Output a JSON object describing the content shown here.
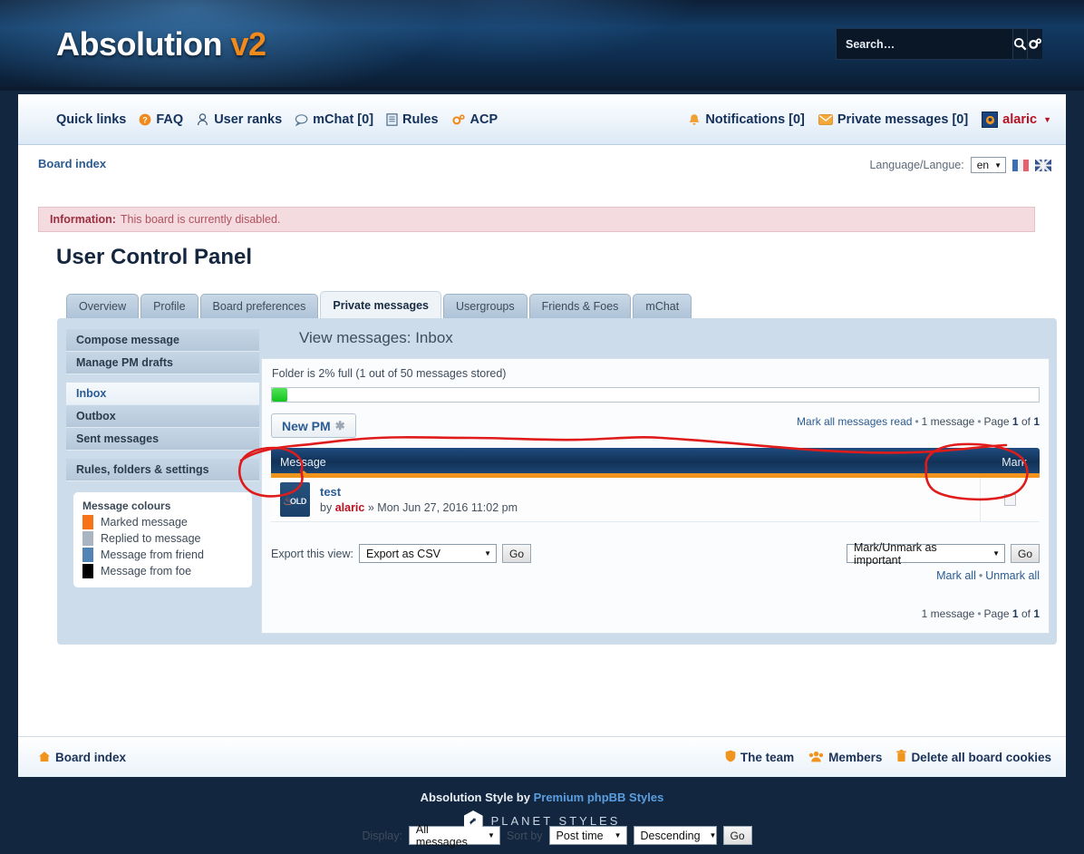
{
  "header": {
    "logo_main": "Absolution",
    "logo_suffix": "v2",
    "search_placeholder": "Search…",
    "search_value": "",
    "search_icon": "magnifier-icon",
    "search_options_icon": "gears-icon"
  },
  "nav": {
    "left": [
      {
        "label": "Quick links",
        "icon": "hamburger-icon"
      },
      {
        "label": "FAQ",
        "icon": "question-circle-icon"
      },
      {
        "label": "User ranks",
        "icon": "ranks-icon"
      },
      {
        "label": "mChat [0]",
        "icon": "chat-bubble-icon"
      },
      {
        "label": "Rules",
        "icon": "document-icon"
      },
      {
        "label": "ACP",
        "icon": "gears-icon"
      }
    ],
    "right": [
      {
        "label": "Notifications [0]",
        "icon": "bell-icon"
      },
      {
        "label": "Private messages [0]",
        "icon": "envelope-icon"
      }
    ],
    "username": "alaric",
    "user_avatar_icon": "avatar-icon",
    "user_caret": "▼"
  },
  "breadcrumb": {
    "label": "Board index",
    "icon": "none"
  },
  "language": {
    "label": "Language/Langue:",
    "selected": "en",
    "caret": "▼",
    "flags": [
      "flag-fr",
      "flag-gb"
    ]
  },
  "alert": {
    "label": "Information:",
    "text": "This board is currently disabled."
  },
  "page_title": "User Control Panel",
  "tabs": [
    {
      "label": "Overview",
      "active": false
    },
    {
      "label": "Profile",
      "active": false
    },
    {
      "label": "Board preferences",
      "active": false
    },
    {
      "label": "Private messages",
      "active": true
    },
    {
      "label": "Usergroups",
      "active": false
    },
    {
      "label": "Friends & Foes",
      "active": false
    },
    {
      "label": "mChat",
      "active": false
    }
  ],
  "sidebar": {
    "group1": [
      {
        "label": "Compose message",
        "active": false
      },
      {
        "label": "Manage PM drafts",
        "active": false
      }
    ],
    "group2": [
      {
        "label": "Inbox",
        "active": true
      },
      {
        "label": "Outbox",
        "active": false
      },
      {
        "label": "Sent messages",
        "active": false
      }
    ],
    "group3": [
      {
        "label": "Rules, folders & settings",
        "active": false
      }
    ],
    "colours": {
      "title": "Message colours",
      "items": [
        {
          "label": "Marked message",
          "color": "#F87217"
        },
        {
          "label": "Replied to message",
          "color": "#A9B5C0"
        },
        {
          "label": "Message from friend",
          "color": "#5283B5"
        },
        {
          "label": "Message from foe",
          "color": "#000000"
        }
      ]
    }
  },
  "main": {
    "view_title": "View messages: Inbox",
    "folder_status": "Folder is 2% full (1 out of 50 messages stored)",
    "folder_percent": 2,
    "new_pm_label": "New PM",
    "new_pm_icon": "star-icon",
    "mark_all_read": "Mark all messages read",
    "count_top": "1 message",
    "page_label_top": "Page",
    "page_cur_top": "1",
    "page_of_top": "of",
    "page_total_top": "1",
    "table": {
      "columns": [
        "Message",
        "Mark"
      ],
      "sort_indicator": "ascending-arrow",
      "rows": [
        {
          "icon": "pm-old-icon",
          "icon_text": "OLD",
          "subject": "test",
          "by_prefix": "by",
          "author": "alaric",
          "separator": "»",
          "date": "Mon Jun 27, 2016 11:02 pm",
          "mark_checked": false
        }
      ]
    },
    "export_label": "Export this view:",
    "export_selected": "Export as CSV",
    "export_go": "Go",
    "bulk_selected": "Mark/Unmark as important",
    "bulk_go": "Go",
    "mark_all": "Mark all",
    "unmark_all": "Unmark all",
    "count_bottom": "1 message",
    "page_label_bottom": "Page",
    "page_cur_bottom": "1",
    "page_of_bottom": "of",
    "page_total_bottom": "1",
    "display_label": "Display:",
    "display_selected": "All messages",
    "sortby_label": "Sort by",
    "sortby_selected": "Post time",
    "sortdir_selected": "Descending",
    "display_go": "Go"
  },
  "footer": {
    "board_index": "Board index",
    "board_index_icon": "home-icon",
    "links": [
      {
        "label": "The team",
        "icon": "shield-icon"
      },
      {
        "label": "Members",
        "icon": "users-icon"
      },
      {
        "label": "Delete all board cookies",
        "icon": "trash-icon"
      }
    ],
    "credit_prefix": "Absolution Style by",
    "credit_link": "Premium phpBB Styles",
    "brand": "PLANET STYLES",
    "brand_icon": "rocket-hex-icon"
  },
  "annotations": {
    "color": "#e01b1b",
    "shapes": [
      "circle-message-header",
      "circle-mark-header",
      "wavy-line-across-header"
    ]
  }
}
